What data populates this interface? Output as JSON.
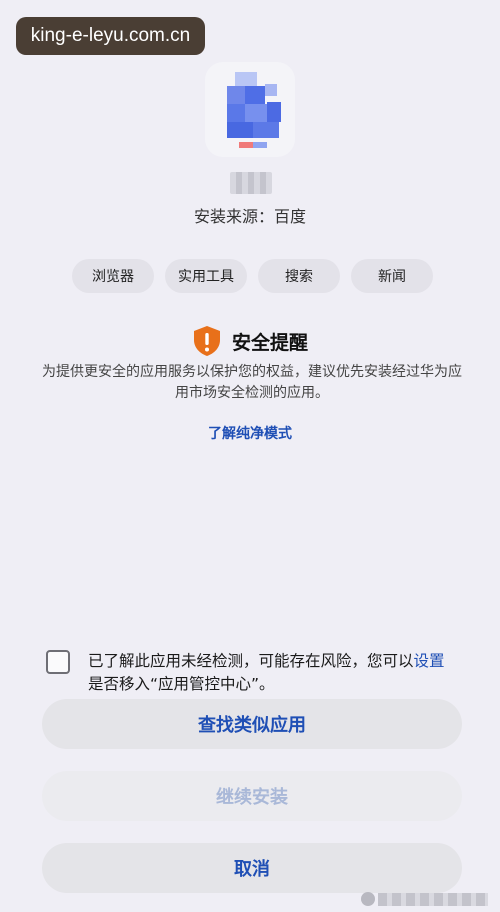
{
  "watermark_top": "king-e-leyu.com.cn",
  "source_label": "安装来源：百度",
  "tags": [
    "浏览器",
    "实用工具",
    "搜索",
    "新闻"
  ],
  "alert": {
    "title": "安全提醒",
    "description": "为提供更安全的应用服务以保护您的权益，建议优先安装经过华为应用市场安全检测的应用。",
    "learn_more": "了解纯净模式"
  },
  "consent": {
    "text_before": "已了解此应用未经检测，可能存在风险，您可以",
    "link": "设置",
    "text_after": "是否移入“应用管控中心”。",
    "checked": false
  },
  "buttons": {
    "find_similar": "查找类似应用",
    "continue_install": "继续安装",
    "cancel": "取消"
  },
  "colors": {
    "background": "#efeef5",
    "accent": "#1f4fb5",
    "warning": "#e8701a"
  },
  "icons": {
    "app": "app-icon-pixelated",
    "alert": "shield-exclamation-icon",
    "watermark": "watermark-logo-icon"
  }
}
